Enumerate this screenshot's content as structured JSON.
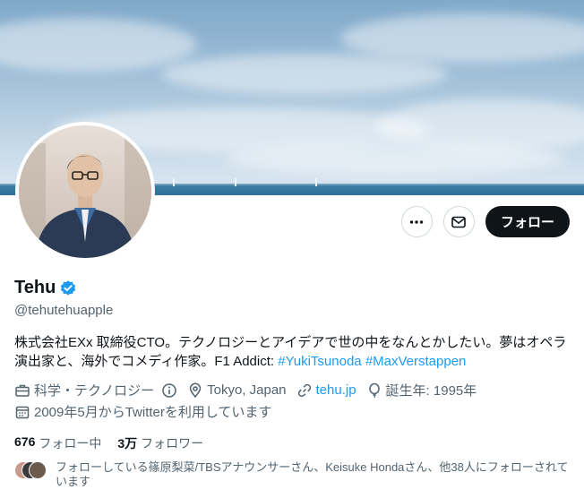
{
  "profile": {
    "display_name": "Tehu",
    "handle": "@tehutehuapple",
    "bio_text": "株式会社EXx 取締役CTO。テクノロジーとアイデアで世の中をなんとかしたい。夢はオペラ演出家と、海外でコメディ作家。F1 Addict: ",
    "bio_hashtags": [
      "#YukiTsunoda",
      "#MaxVerstappen"
    ],
    "verified": true,
    "verified_color": "#1d9bf0"
  },
  "actions": {
    "more_icon": "more-icon",
    "message_icon": "mail-icon",
    "follow_label": "フォロー"
  },
  "meta": {
    "category": "科学・テクノロジー",
    "location": "Tokyo, Japan",
    "website": "tehu.jp",
    "birthday": "誕生年: 1995年",
    "joined": "2009年5月からTwitterを利用しています"
  },
  "counts": {
    "following_num": "676",
    "following_label": "フォロー中",
    "followers_num": "3万",
    "followers_label": "フォロワー"
  },
  "followed_by": {
    "text": "フォローしている篠原梨菜/TBSアナウンサーさん、Keisuke Hondaさん、他38人にフォローされています"
  },
  "colors": {
    "accent": "#1d9bf0",
    "text_primary": "#0f1419",
    "text_secondary": "#536471",
    "follow_button_bg": "#0f1419"
  }
}
